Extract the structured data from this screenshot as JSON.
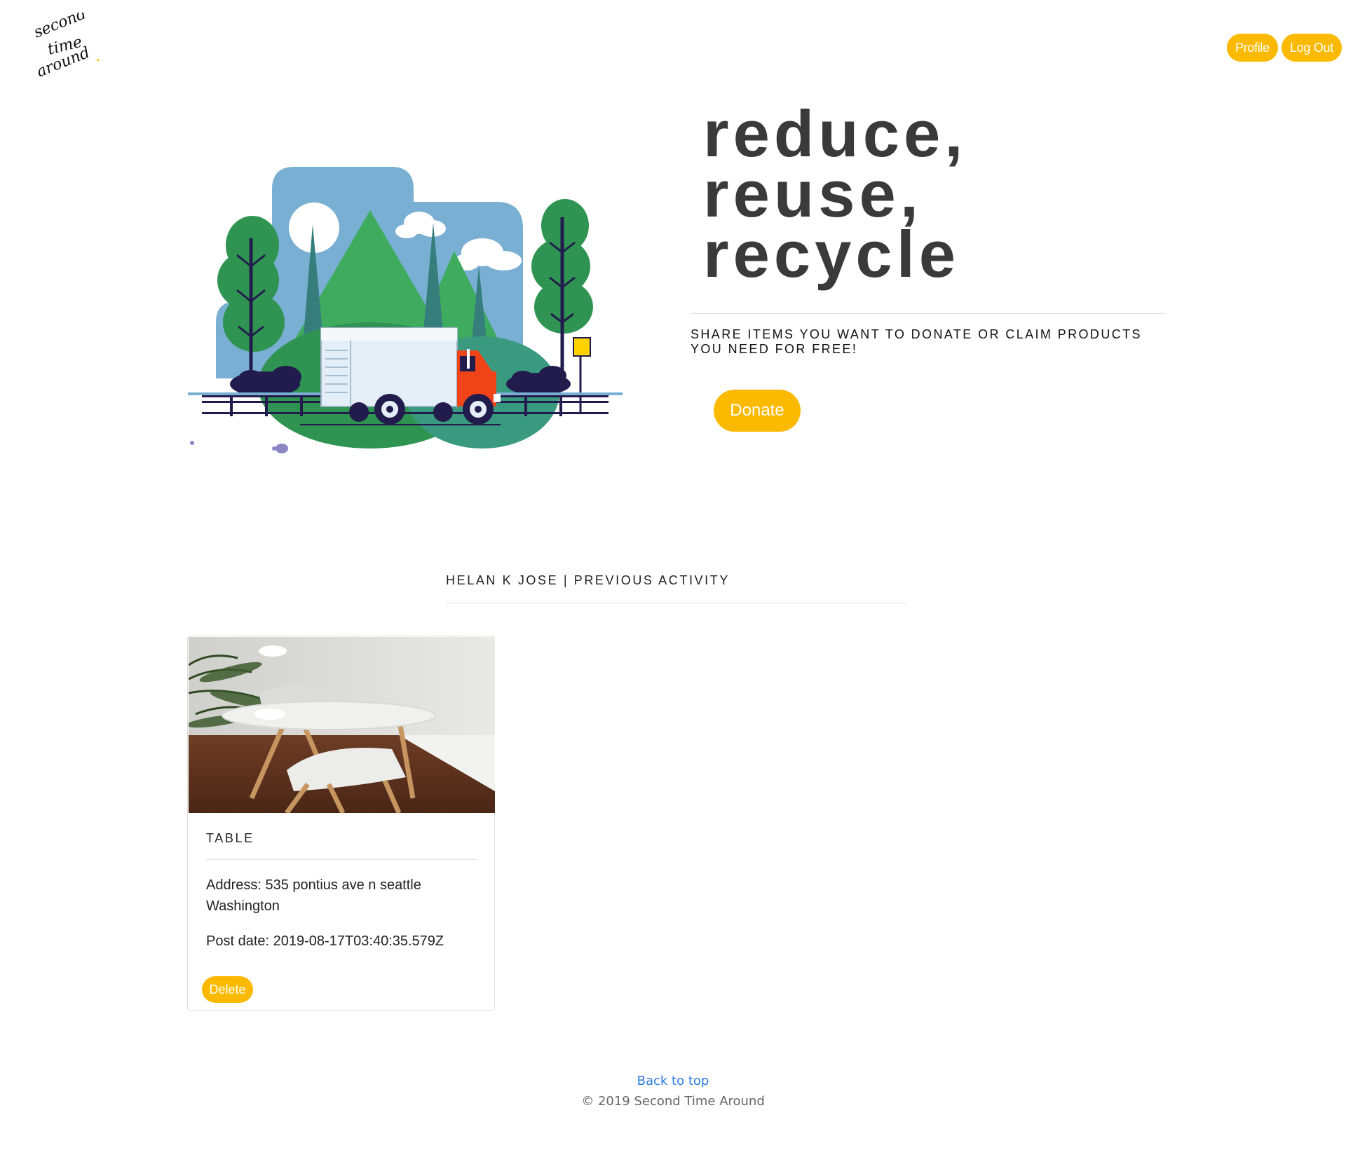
{
  "header": {
    "logo_text": [
      "second",
      "time",
      "around"
    ],
    "profile_label": "Profile",
    "logout_label": "Log Out"
  },
  "hero": {
    "title_lines": [
      "reduce,",
      "reuse,",
      "recycle"
    ],
    "subtitle": "SHARE ITEMS YOU WANT TO DONATE OR CLAIM PRODUCTS YOU NEED FOR FREE!",
    "donate_label": "Donate"
  },
  "activity": {
    "heading": "HELAN K JOSE | PREVIOUS ACTIVITY",
    "items": [
      {
        "title": "TABLE",
        "address": "Address: 535 pontius ave n seattle Washington",
        "post_date": "Post date: 2019-08-17T03:40:35.579Z",
        "delete_label": "Delete"
      }
    ]
  },
  "footer": {
    "back_to_top": "Back to top",
    "copyright": "© 2019 Second Time Around"
  },
  "colors": {
    "accent": "#fbba00",
    "link": "#2a7ae2",
    "heading": "#3a3a3a"
  }
}
